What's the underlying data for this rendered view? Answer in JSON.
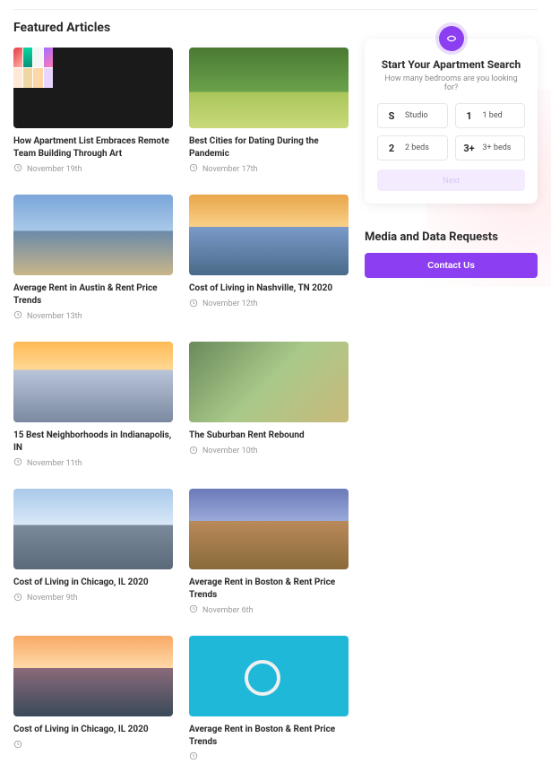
{
  "section_title": "Featured Articles",
  "articles": [
    {
      "title": "How Apartment List Embraces Remote Team Building Through Art",
      "date": "November 19th",
      "thumb": "art"
    },
    {
      "title": "Best Cities for Dating During the Pandemic",
      "date": "November 17th",
      "thumb": "bench"
    },
    {
      "title": "Average Rent in Austin & Rent Price Trends",
      "date": "November 13th",
      "thumb": "austin"
    },
    {
      "title": "Cost of Living in Nashville, TN 2020",
      "date": "November 12th",
      "thumb": "nash"
    },
    {
      "title": "15 Best Neighborhoods in Indianapolis, IN",
      "date": "November 11th",
      "thumb": "indy"
    },
    {
      "title": "The Suburban Rent Rebound",
      "date": "November 10th",
      "thumb": "subs"
    },
    {
      "title": "Cost of Living in Chicago, IL 2020",
      "date": "November 9th",
      "thumb": "chi"
    },
    {
      "title": "Average Rent in Boston & Rent Price Trends",
      "date": "November 6th",
      "thumb": "bos"
    },
    {
      "title": "Cost of Living in Chicago, IL 2020",
      "date": "",
      "thumb": "sea"
    },
    {
      "title": "Average Rent in Boston & Rent Price Trends",
      "date": "",
      "thumb": "key"
    }
  ],
  "search": {
    "title": "Start Your Apartment Search",
    "subtitle": "How many bedrooms are you looking for?",
    "options": [
      {
        "key": "S",
        "label": "Studio"
      },
      {
        "key": "1",
        "label": "1 bed"
      },
      {
        "key": "2",
        "label": "2 beds"
      },
      {
        "key": "3+",
        "label": "3+ beds"
      }
    ],
    "next": "Next"
  },
  "media": {
    "title": "Media and Data Requests",
    "button": "Contact Us"
  }
}
